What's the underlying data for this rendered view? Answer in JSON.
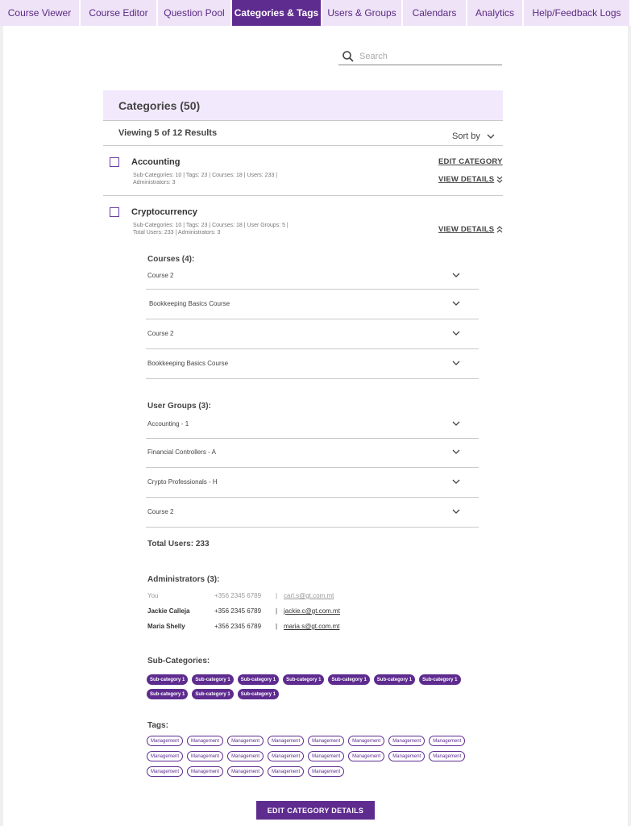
{
  "nav": {
    "tabs": [
      {
        "label": "Course Viewer",
        "active": false
      },
      {
        "label": "Course Editor",
        "active": false
      },
      {
        "label": "Question Pool",
        "active": false
      },
      {
        "label": "Categories & Tags",
        "active": true
      },
      {
        "label": "Users & Groups",
        "active": false
      },
      {
        "label": "Calendars",
        "active": false
      },
      {
        "label": "Analytics",
        "active": false
      },
      {
        "label": "Help/Feedback Logs",
        "active": false
      }
    ]
  },
  "search": {
    "placeholder": "Search",
    "icon": "search-icon"
  },
  "categories": {
    "title": "Categories (50)",
    "viewing": "Viewing 5 of 12 Results",
    "sort_label": "Sort by",
    "items": [
      {
        "name": "Accounting",
        "meta_line1": "Sub-Categories: 10  |  Tags: 23  |  Courses: 18  |  Users: 233  |",
        "meta_line2": "Administrators: 3",
        "edit_label": "EDIT CATEGORY",
        "view_label": "VIEW DETAILS"
      },
      {
        "name": "Cryptocurrency",
        "meta_line1": "Sub-Categories: 10  |  Tags: 23  |  Courses: 18  |  User Groups: 5  |",
        "meta_line2": "Total Users: 233  |  Administrators: 3",
        "view_label": "VIEW DETAILS"
      }
    ]
  },
  "details": {
    "courses_label": "Courses (4):",
    "courses": [
      "Course 2",
      "Bookkeeping Basics Course",
      "Course 2",
      "Bookkeeping Basics Course"
    ],
    "groups_label": "User Groups (3):",
    "groups": [
      "Accounting - 1",
      "Financial Controllers - A",
      "Crypto Professionals - H",
      "Course 2"
    ],
    "total_users": "Total Users: 233",
    "admins_label": "Administrators (3):",
    "admins": [
      {
        "name": "You",
        "phone": "+356 2345 6789",
        "sep": "|",
        "email": "carl.s@gt.com.mt"
      },
      {
        "name": "Jackie Calleja",
        "phone": "+356 2345 6789",
        "sep": "|",
        "email": "jackie.c@gt.com.mt"
      },
      {
        "name": "Maria Shelly",
        "phone": "+356 2345 6789",
        "sep": "|",
        "email": "maria.s@gt.com.mt"
      }
    ],
    "subcats_label": "Sub-Categories:",
    "subcats": [
      "Sub-category 1",
      "Sub-category 1",
      "Sub-category 1",
      "Sub-category 1",
      "Sub-category 1",
      "Sub-category 1",
      "Sub-category 1",
      "Sub-category 1",
      "Sub-category 1",
      "Sub-category 1"
    ],
    "tags_label": "Tags:",
    "tags": [
      "Management",
      "Management",
      "Management",
      "Management",
      "Management",
      "Management",
      "Management",
      "Management",
      "Management",
      "Management",
      "Management",
      "Management",
      "Management",
      "Management",
      "Management",
      "Management",
      "Management",
      "Management",
      "Management",
      "Management",
      "Management"
    ]
  },
  "edit_button_label": "EDIT CATEGORY DETAILS",
  "colors": {
    "accent": "#5e2b8f",
    "header_bg": "#f3e9fc",
    "nav_bg": "#efe3f7"
  }
}
